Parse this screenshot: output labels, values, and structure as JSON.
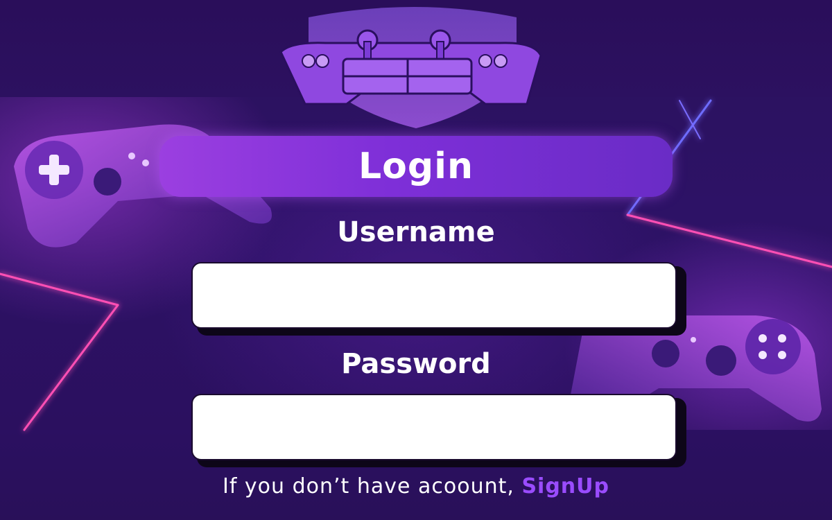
{
  "login": {
    "title": "Login"
  },
  "username": {
    "label": "Username",
    "value": "",
    "placeholder": ""
  },
  "password": {
    "label": "Password",
    "value": "",
    "placeholder": ""
  },
  "footer": {
    "prompt": "If you don’t have acoount, ",
    "signup_label": "SignUp"
  },
  "colors": {
    "background": "#2a0f5e",
    "banner_start": "#9b3fe0",
    "banner_end": "#6a2cc6",
    "link": "#9a4cff",
    "neon_pink": "#ff3ca0",
    "neon_blue": "#5a5aff"
  },
  "icons": [
    "shield-gamepad-logo-icon",
    "gamepad-left-icon",
    "gamepad-right-icon"
  ]
}
